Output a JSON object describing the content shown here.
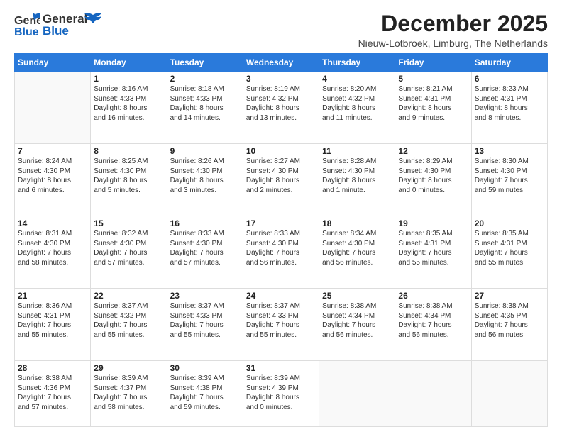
{
  "header": {
    "logo_general": "General",
    "logo_blue": "Blue",
    "month_title": "December 2025",
    "location": "Nieuw-Lotbroek, Limburg, The Netherlands"
  },
  "days_of_week": [
    "Sunday",
    "Monday",
    "Tuesday",
    "Wednesday",
    "Thursday",
    "Friday",
    "Saturday"
  ],
  "weeks": [
    [
      {
        "day": "",
        "info": ""
      },
      {
        "day": "1",
        "info": "Sunrise: 8:16 AM\nSunset: 4:33 PM\nDaylight: 8 hours\nand 16 minutes."
      },
      {
        "day": "2",
        "info": "Sunrise: 8:18 AM\nSunset: 4:33 PM\nDaylight: 8 hours\nand 14 minutes."
      },
      {
        "day": "3",
        "info": "Sunrise: 8:19 AM\nSunset: 4:32 PM\nDaylight: 8 hours\nand 13 minutes."
      },
      {
        "day": "4",
        "info": "Sunrise: 8:20 AM\nSunset: 4:32 PM\nDaylight: 8 hours\nand 11 minutes."
      },
      {
        "day": "5",
        "info": "Sunrise: 8:21 AM\nSunset: 4:31 PM\nDaylight: 8 hours\nand 9 minutes."
      },
      {
        "day": "6",
        "info": "Sunrise: 8:23 AM\nSunset: 4:31 PM\nDaylight: 8 hours\nand 8 minutes."
      }
    ],
    [
      {
        "day": "7",
        "info": "Sunrise: 8:24 AM\nSunset: 4:30 PM\nDaylight: 8 hours\nand 6 minutes."
      },
      {
        "day": "8",
        "info": "Sunrise: 8:25 AM\nSunset: 4:30 PM\nDaylight: 8 hours\nand 5 minutes."
      },
      {
        "day": "9",
        "info": "Sunrise: 8:26 AM\nSunset: 4:30 PM\nDaylight: 8 hours\nand 3 minutes."
      },
      {
        "day": "10",
        "info": "Sunrise: 8:27 AM\nSunset: 4:30 PM\nDaylight: 8 hours\nand 2 minutes."
      },
      {
        "day": "11",
        "info": "Sunrise: 8:28 AM\nSunset: 4:30 PM\nDaylight: 8 hours\nand 1 minute."
      },
      {
        "day": "12",
        "info": "Sunrise: 8:29 AM\nSunset: 4:30 PM\nDaylight: 8 hours\nand 0 minutes."
      },
      {
        "day": "13",
        "info": "Sunrise: 8:30 AM\nSunset: 4:30 PM\nDaylight: 7 hours\nand 59 minutes."
      }
    ],
    [
      {
        "day": "14",
        "info": "Sunrise: 8:31 AM\nSunset: 4:30 PM\nDaylight: 7 hours\nand 58 minutes."
      },
      {
        "day": "15",
        "info": "Sunrise: 8:32 AM\nSunset: 4:30 PM\nDaylight: 7 hours\nand 57 minutes."
      },
      {
        "day": "16",
        "info": "Sunrise: 8:33 AM\nSunset: 4:30 PM\nDaylight: 7 hours\nand 57 minutes."
      },
      {
        "day": "17",
        "info": "Sunrise: 8:33 AM\nSunset: 4:30 PM\nDaylight: 7 hours\nand 56 minutes."
      },
      {
        "day": "18",
        "info": "Sunrise: 8:34 AM\nSunset: 4:30 PM\nDaylight: 7 hours\nand 56 minutes."
      },
      {
        "day": "19",
        "info": "Sunrise: 8:35 AM\nSunset: 4:31 PM\nDaylight: 7 hours\nand 55 minutes."
      },
      {
        "day": "20",
        "info": "Sunrise: 8:35 AM\nSunset: 4:31 PM\nDaylight: 7 hours\nand 55 minutes."
      }
    ],
    [
      {
        "day": "21",
        "info": "Sunrise: 8:36 AM\nSunset: 4:31 PM\nDaylight: 7 hours\nand 55 minutes."
      },
      {
        "day": "22",
        "info": "Sunrise: 8:37 AM\nSunset: 4:32 PM\nDaylight: 7 hours\nand 55 minutes."
      },
      {
        "day": "23",
        "info": "Sunrise: 8:37 AM\nSunset: 4:33 PM\nDaylight: 7 hours\nand 55 minutes."
      },
      {
        "day": "24",
        "info": "Sunrise: 8:37 AM\nSunset: 4:33 PM\nDaylight: 7 hours\nand 55 minutes."
      },
      {
        "day": "25",
        "info": "Sunrise: 8:38 AM\nSunset: 4:34 PM\nDaylight: 7 hours\nand 56 minutes."
      },
      {
        "day": "26",
        "info": "Sunrise: 8:38 AM\nSunset: 4:34 PM\nDaylight: 7 hours\nand 56 minutes."
      },
      {
        "day": "27",
        "info": "Sunrise: 8:38 AM\nSunset: 4:35 PM\nDaylight: 7 hours\nand 56 minutes."
      }
    ],
    [
      {
        "day": "28",
        "info": "Sunrise: 8:38 AM\nSunset: 4:36 PM\nDaylight: 7 hours\nand 57 minutes."
      },
      {
        "day": "29",
        "info": "Sunrise: 8:39 AM\nSunset: 4:37 PM\nDaylight: 7 hours\nand 58 minutes."
      },
      {
        "day": "30",
        "info": "Sunrise: 8:39 AM\nSunset: 4:38 PM\nDaylight: 7 hours\nand 59 minutes."
      },
      {
        "day": "31",
        "info": "Sunrise: 8:39 AM\nSunset: 4:39 PM\nDaylight: 8 hours\nand 0 minutes."
      },
      {
        "day": "",
        "info": ""
      },
      {
        "day": "",
        "info": ""
      },
      {
        "day": "",
        "info": ""
      }
    ]
  ]
}
